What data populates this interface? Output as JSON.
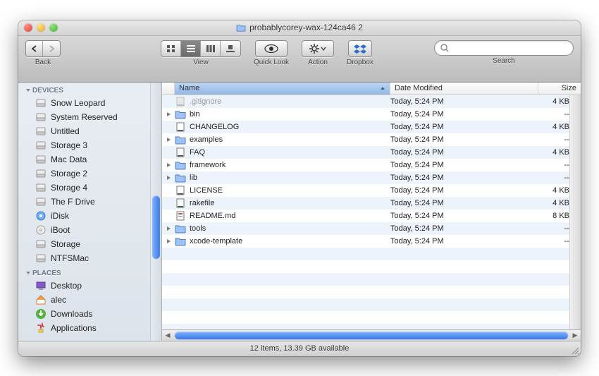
{
  "window": {
    "title": "probablycorey-wax-124ca46 2"
  },
  "toolbar": {
    "back_label": "Back",
    "view_label": "View",
    "quicklook_label": "Quick Look",
    "action_label": "Action",
    "dropbox_label": "Dropbox",
    "search_label": "Search",
    "search_placeholder": ""
  },
  "sidebar": {
    "sections": [
      {
        "label": "DEVICES",
        "items": [
          {
            "label": "Snow Leopard",
            "icon": "hdd"
          },
          {
            "label": "System Reserved",
            "icon": "hdd"
          },
          {
            "label": "Untitled",
            "icon": "hdd"
          },
          {
            "label": "Storage 3",
            "icon": "hdd"
          },
          {
            "label": "Mac Data",
            "icon": "hdd"
          },
          {
            "label": "Storage 2",
            "icon": "hdd"
          },
          {
            "label": "Storage 4",
            "icon": "hdd"
          },
          {
            "label": "The F Drive",
            "icon": "hdd"
          },
          {
            "label": "iDisk",
            "icon": "idisk"
          },
          {
            "label": "iBoot",
            "icon": "disc"
          },
          {
            "label": "Storage",
            "icon": "hdd"
          },
          {
            "label": "NTFSMac",
            "icon": "hdd"
          }
        ]
      },
      {
        "label": "PLACES",
        "items": [
          {
            "label": "Desktop",
            "icon": "desktop"
          },
          {
            "label": "alec",
            "icon": "home"
          },
          {
            "label": "Downloads",
            "icon": "downloads"
          },
          {
            "label": "Applications",
            "icon": "apps"
          }
        ]
      }
    ]
  },
  "columns": {
    "name": "Name",
    "date": "Date Modified",
    "size": "Size"
  },
  "files": [
    {
      "name": ".gitignore",
      "date": "Today, 5:24 PM",
      "size": "4 KB",
      "kind": "file",
      "grey": true,
      "disclosure": false
    },
    {
      "name": "bin",
      "date": "Today, 5:24 PM",
      "size": "--",
      "kind": "folder",
      "grey": false,
      "disclosure": true
    },
    {
      "name": "CHANGELOG",
      "date": "Today, 5:24 PM",
      "size": "4 KB",
      "kind": "file",
      "grey": false,
      "disclosure": false
    },
    {
      "name": "examples",
      "date": "Today, 5:24 PM",
      "size": "--",
      "kind": "folder",
      "grey": false,
      "disclosure": true
    },
    {
      "name": "FAQ",
      "date": "Today, 5:24 PM",
      "size": "4 KB",
      "kind": "file",
      "grey": false,
      "disclosure": false
    },
    {
      "name": "framework",
      "date": "Today, 5:24 PM",
      "size": "--",
      "kind": "folder",
      "grey": false,
      "disclosure": true
    },
    {
      "name": "lib",
      "date": "Today, 5:24 PM",
      "size": "--",
      "kind": "folder",
      "grey": false,
      "disclosure": true
    },
    {
      "name": "LICENSE",
      "date": "Today, 5:24 PM",
      "size": "4 KB",
      "kind": "file",
      "grey": false,
      "disclosure": false
    },
    {
      "name": "rakefile",
      "date": "Today, 5:24 PM",
      "size": "4 KB",
      "kind": "file",
      "grey": false,
      "disclosure": false
    },
    {
      "name": "README.md",
      "date": "Today, 5:24 PM",
      "size": "8 KB",
      "kind": "readme",
      "grey": false,
      "disclosure": false
    },
    {
      "name": "tools",
      "date": "Today, 5:24 PM",
      "size": "--",
      "kind": "folder",
      "grey": false,
      "disclosure": true
    },
    {
      "name": "xcode-template",
      "date": "Today, 5:24 PM",
      "size": "--",
      "kind": "folder",
      "grey": false,
      "disclosure": true
    }
  ],
  "status": "12 items, 13.39 GB available"
}
